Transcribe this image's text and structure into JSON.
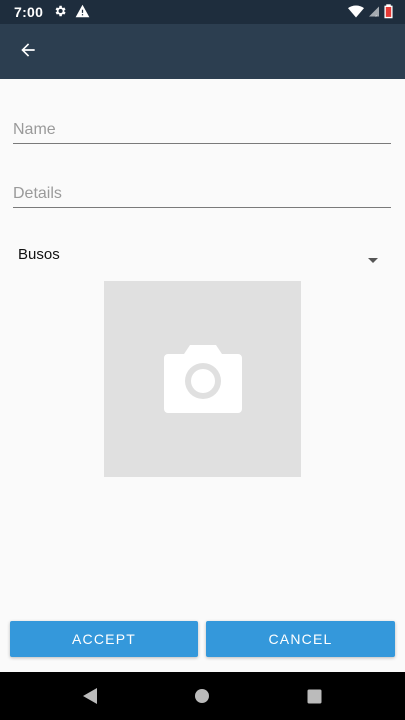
{
  "status_bar": {
    "time": "7:00",
    "left_icons": [
      "gear-icon",
      "warning-icon"
    ],
    "right_icons": [
      "wifi-icon",
      "signal-icon",
      "battery-icon"
    ]
  },
  "app_bar": {
    "back_icon": "arrow-left-icon",
    "color": "#2c3e50"
  },
  "form": {
    "name_placeholder": "Name",
    "name_value": "",
    "details_placeholder": "Details",
    "details_value": "",
    "category_selected": "Busos",
    "photo_icon": "camera-icon"
  },
  "actions": {
    "accept_label": "ACCEPT",
    "cancel_label": "CANCEL",
    "button_color": "#3498db"
  },
  "nav_bar": {
    "items": [
      "back-triangle-icon",
      "home-circle-icon",
      "recents-square-icon"
    ]
  }
}
